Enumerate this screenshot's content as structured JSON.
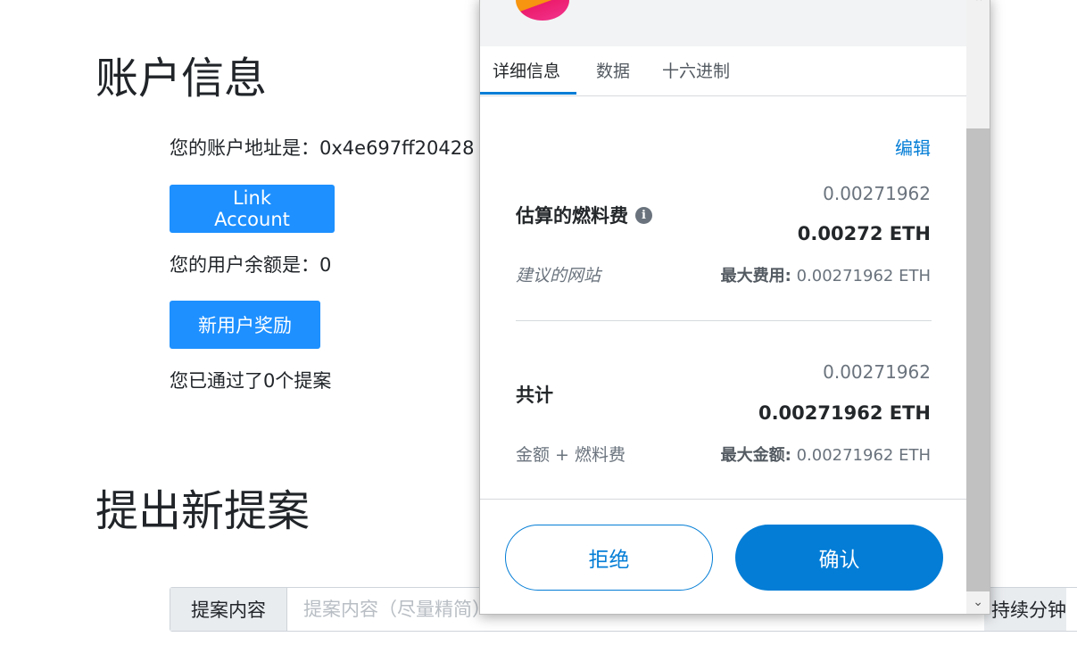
{
  "page": {
    "account_heading": "账户信息",
    "address_text": "您的账户地址是：0x4e697ff20428",
    "link_account_label": "Link Account",
    "balance_text": "您的用户余额是：0",
    "new_user_bonus_label": "新用户奖励",
    "passed_text": "您已通过了0个提案",
    "new_proposal_heading": "提出新提案",
    "proposal_prepend": "提案内容",
    "proposal_placeholder": "提案内容（尽量精简）",
    "duration_append": "持续分钟"
  },
  "popup": {
    "tabs": [
      "详细信息",
      "数据",
      "十六进制"
    ],
    "active_tab": "详细信息",
    "edit_label": "编辑",
    "gas": {
      "label": "估算的燃料费",
      "secondary_value": "0.00271962",
      "primary_value": "0.00272 ETH",
      "sub_label": "建议的网站",
      "max_label": "最大费用:",
      "max_value": "0.00271962 ETH"
    },
    "total": {
      "label": "共计",
      "secondary_value": "0.00271962",
      "primary_value": "0.00271962 ETH",
      "sub_label": "金额 + 燃料费",
      "max_label": "最大金额:",
      "max_value": "0.00271962 ETH"
    },
    "reject_label": "拒绝",
    "confirm_label": "确认",
    "info_icon": "i"
  },
  "colors": {
    "brand_blue": "#037dd6",
    "dapp_button": "#1e90ff"
  }
}
